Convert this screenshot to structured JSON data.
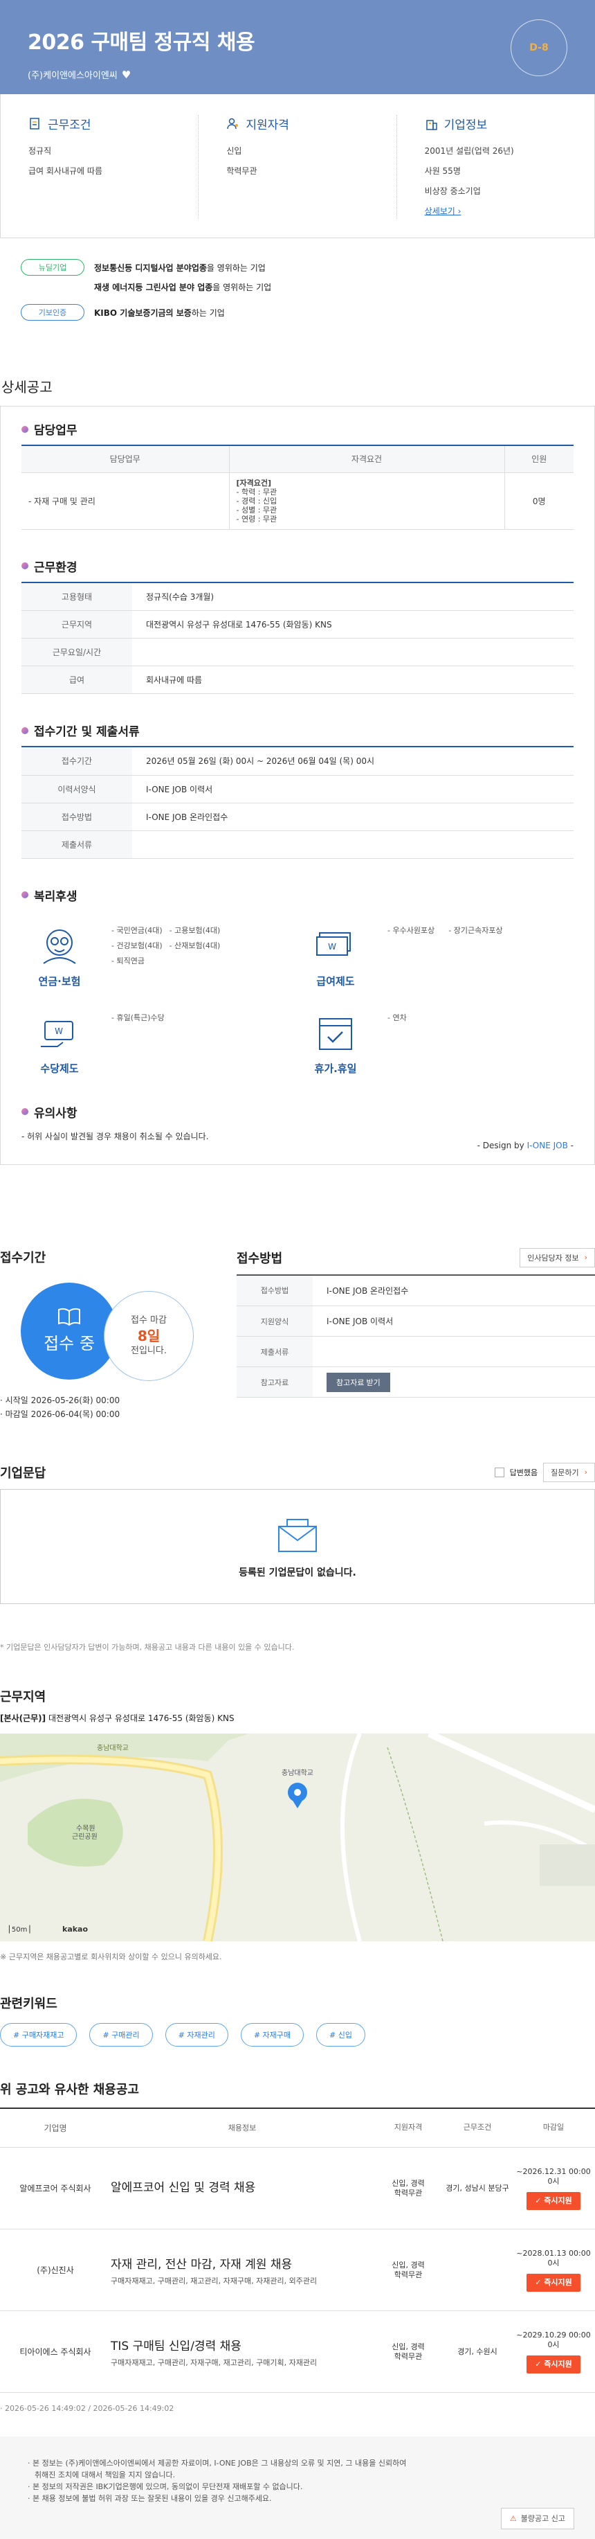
{
  "hero": {
    "title": "2026 구매팀 정규직 채용",
    "company": "(주)케이앤에스아이엔씨",
    "heart": "♥",
    "dday": "D-8"
  },
  "summary": {
    "work": {
      "title": "근무조건",
      "items": [
        "정규직",
        "급여 회사내규에 따름"
      ]
    },
    "qual": {
      "title": "지원자격",
      "items": [
        "신입",
        "학력무관"
      ]
    },
    "company": {
      "title": "기업정보",
      "items": [
        "2001년 설립(업력 26년)",
        "사원 55명",
        "비상장 중소기업"
      ],
      "more": "상세보기 ›"
    }
  },
  "badges": [
    {
      "label": "뉴딜기업",
      "strong": "정보통신등 디지털사업 분야업종",
      "rest": "을 영위하는 기업",
      "color": "green"
    },
    {
      "label": "",
      "strong": "재생 에너지등 그린사업 분야 업종",
      "rest": "을 영위하는 기업",
      "color": "none"
    },
    {
      "label": "기보인증",
      "strong": "KIBO 기술보증기금의 보증",
      "rest": "하는 기업",
      "color": "blue"
    }
  ],
  "detail": {
    "section_title": "상세공고",
    "duty": {
      "title": "담당업무",
      "headers": [
        "담당업무",
        "자격요건",
        "인원"
      ],
      "row": {
        "duty": "- 자재 구매 및 관리",
        "req": [
          "[자격요건]",
          "- 학력 : 무관",
          "- 경력 : 신입",
          "- 성별 : 무관",
          "- 연령 : 무관"
        ],
        "count": "0명"
      }
    },
    "env": {
      "title": "근무환경",
      "rows": [
        {
          "k": "고용형태",
          "v": "정규직(수습 3개월)"
        },
        {
          "k": "근무지역",
          "v": "대전광역시 유성구 유성대로 1476-55 (화암동) KNS"
        },
        {
          "k": "근무요일/시간",
          "v": ""
        },
        {
          "k": "급여",
          "v": "회사내규에 따름"
        }
      ]
    },
    "period": {
      "title": "접수기간 및 제출서류",
      "rows": [
        {
          "k": "접수기간",
          "v": "2026년 05월 26일 (화) 00시 ~ 2026년 06월 04일 (목) 00시"
        },
        {
          "k": "이력서양식",
          "v": "I-ONE JOB 이력서"
        },
        {
          "k": "접수방법",
          "v": "I-ONE JOB 온라인접수"
        },
        {
          "k": "제출서류",
          "v": ""
        }
      ]
    },
    "welfare": {
      "title": "복리후생",
      "groups": [
        {
          "label": "연금·보험",
          "icon": "pension-icon",
          "items": [
            "- 국민연금(4대)",
            "- 고용보험(4대)",
            "- 건강보험(4대)",
            "- 산재보험(4대)",
            "- 퇴직연금"
          ]
        },
        {
          "label": "급여제도",
          "icon": "salary-icon",
          "items": [
            "- 우수사원포상",
            "- 장기근속자포상"
          ]
        },
        {
          "label": "수당제도",
          "icon": "allowance-icon",
          "items": [
            "- 휴일(특근)수당"
          ]
        },
        {
          "label": "휴가.휴일",
          "icon": "vacation-icon",
          "items": [
            "- 연차"
          ]
        }
      ]
    },
    "caution": {
      "title": "유의사항",
      "text": "- 허위 사실이 발견될 경우 채용이 취소될 수 있습니다.",
      "design_prefix": "- Design by ",
      "design_brand": "I-ONE JOB",
      "design_suffix": " -"
    }
  },
  "apply": {
    "period_title": "접수기간",
    "status": "접수 중",
    "deadline_label": "접수 마감",
    "days_left": "8일",
    "days_suffix": "전입니다.",
    "start": "· 시작일 2026-05-26(화) 00:00",
    "end": "· 마감일 2026-06-04(목) 00:00",
    "method_title": "접수방법",
    "contact_btn": "인사담당자 정보",
    "rows": [
      {
        "k": "접수방법",
        "v": "I-ONE JOB 온라인접수"
      },
      {
        "k": "지원양식",
        "v": "I-ONE JOB 이력서"
      },
      {
        "k": "제출서류",
        "v": ""
      },
      {
        "k": "참고자료",
        "v": ""
      }
    ],
    "ref_btn": "참고자료 받기"
  },
  "qa": {
    "title": "기업문답",
    "answered": "답변했음",
    "ask": "질문하기",
    "empty": "등록된 기업문답이 없습니다.",
    "note": "* 기업문답은 인사담당자가 답변이 가능하며, 채용공고 내용과 다른 내용이 있을 수 있습니다."
  },
  "location": {
    "title": "근무지역",
    "addr_tag": "[본사(근무)]",
    "addr": "대전광역시 유성구 유성대로 1476-55 (화암동) KNS",
    "map_labels": {
      "university": "충남대학교",
      "campus": "수목원\n근린공원",
      "institute": "충남대학교\n동물병원",
      "scale": "50m",
      "kakao": "kakao"
    },
    "note": "※ 근무지역은 채용공고별로 회사위치와 상이할 수 있으니 유의하세요."
  },
  "keywords": {
    "title": "관련키워드",
    "tags": [
      "# 구매자재재고",
      "# 구매관리",
      "# 자재관리",
      "# 자재구매",
      "# 신입"
    ]
  },
  "similar": {
    "title": "위 공고와 유사한 채용공고",
    "headers": [
      "기업명",
      "채용정보",
      "지원자격",
      "근무조건",
      "마감일"
    ],
    "rows": [
      {
        "company": "알에프코어 주식회사",
        "title": "알에프코어 신입 및 경력 채용",
        "sub": "",
        "qual": "신입, 경력\n학력무관",
        "cond": "경기, 성남시 분당구",
        "deadline": "~2026.12.31 00:00\n0시",
        "btn": "✓ 즉시지원"
      },
      {
        "company": "(주)신진사",
        "title": "자재 관리, 전산 마감, 자재 계원 채용",
        "sub": "구매자재재고, 구매관리, 재고관리, 자재구매, 자재관리, 외주관리",
        "qual": "신입, 경력\n학력무관",
        "cond": "",
        "deadline": "~2028.01.13 00:00\n0시",
        "btn": "✓ 즉시지원"
      },
      {
        "company": "티아이에스 주식회사",
        "title": "TIS 구매팀 신입/경력 채용",
        "sub": "구매자재재고, 구매관리, 자재구매, 재고관리, 구매기획, 자재관리",
        "qual": "신입, 경력\n학력무관",
        "cond": "경기, 수원시",
        "deadline": "~2029.10.29 00:00\n0시",
        "btn": "✓ 즉시지원"
      }
    ]
  },
  "stamp": "· 2026-05-26 14:49:02 / 2026-05-26 14:49:02",
  "footer": {
    "lines": [
      "· 본 정보는 (주)케이앤에스아이엔씨에서 제공한 자료이며, I-ONE JOB은 그 내용상의 오류 및 지연, 그 내용을 신뢰하여",
      "  취해진 조치에 대해서 책임을 지지 않습니다.",
      "· 본 정보의 저작권은 IBK기업은행에 있으며, 동의없이 무단전재 재배포할 수 없습니다.",
      "· 본 채용 정보에 불법 허위 과장 또는 잘못된 내용이 있을 경우 신고해주세요."
    ],
    "report": "불량공고 신고"
  },
  "colors": {
    "hero": "#6f8fc4",
    "accent": "#1f5aa6",
    "apply": "#f5502b",
    "blue": "#2e86e8"
  }
}
